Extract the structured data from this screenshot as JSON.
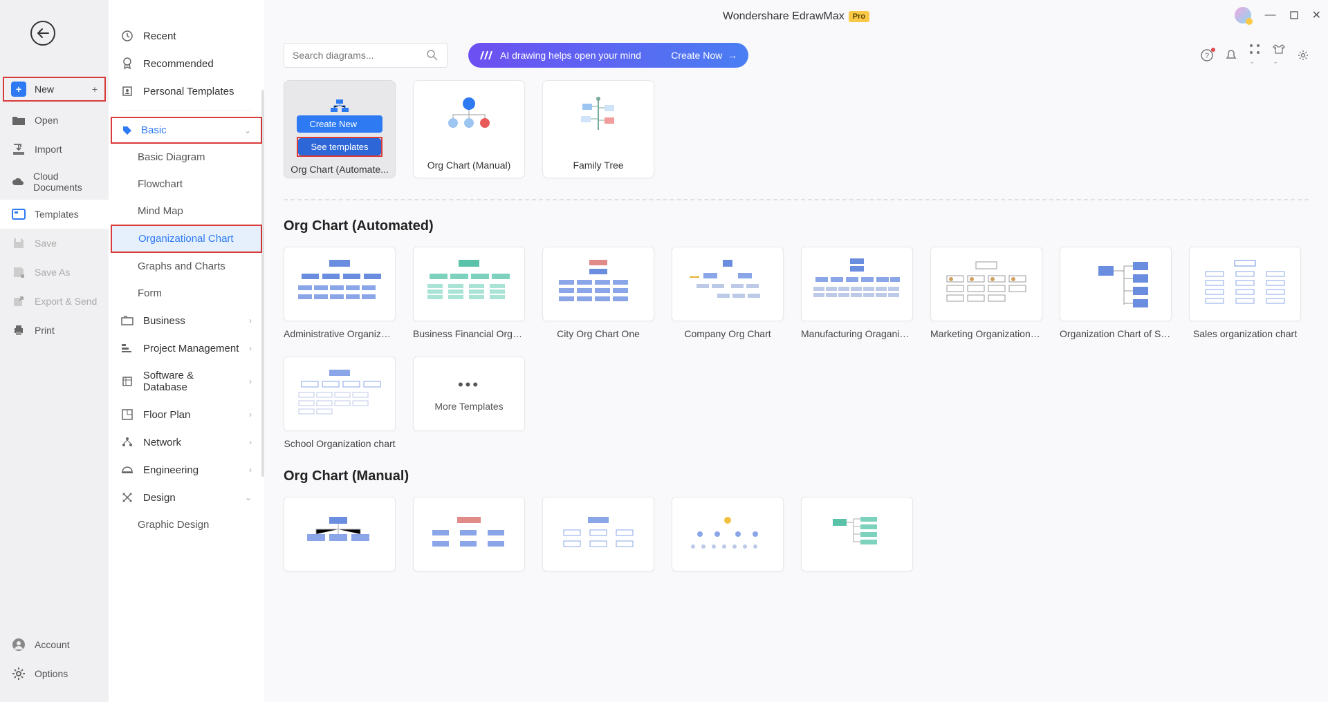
{
  "app": {
    "title": "Wondershare EdrawMax",
    "badge": "Pro"
  },
  "narrow": {
    "new": "New",
    "open": "Open",
    "import": "Import",
    "cloud": "Cloud Documents",
    "templates": "Templates",
    "save": "Save",
    "saveas": "Save As",
    "export": "Export & Send",
    "print": "Print",
    "account": "Account",
    "options": "Options"
  },
  "wide": {
    "recent": "Recent",
    "recommended": "Recommended",
    "personal": "Personal Templates",
    "basic": "Basic",
    "basic_diagram": "Basic Diagram",
    "flowchart": "Flowchart",
    "mindmap": "Mind Map",
    "org": "Organizational Chart",
    "graphs": "Graphs and Charts",
    "form": "Form",
    "business": "Business",
    "project": "Project Management",
    "software": "Software & Database",
    "floor": "Floor Plan",
    "network": "Network",
    "engineering": "Engineering",
    "design": "Design",
    "graphic": "Graphic Design"
  },
  "search": {
    "placeholder": "Search diagrams..."
  },
  "ai": {
    "text": "AI drawing helps open your mind",
    "cta": "Create Now"
  },
  "cards": {
    "create_new": "Create New",
    "see_templates": "See templates",
    "auto": "Org Chart (Automate...",
    "manual": "Org Chart (Manual)",
    "family": "Family Tree"
  },
  "sections": {
    "auto_title": "Org Chart (Automated)",
    "manual_title": "Org Chart (Manual)"
  },
  "templates_auto": [
    "Administrative Organizatio...",
    "Business Financial Organiz...",
    "City Org Chart One",
    "Company Org Chart",
    "Manufacturing Oraganizati...",
    "Marketing Organization Ch...",
    "Organization Chart of Sale...",
    "Sales organization chart",
    "School Organization chart"
  ],
  "more": "More Templates"
}
